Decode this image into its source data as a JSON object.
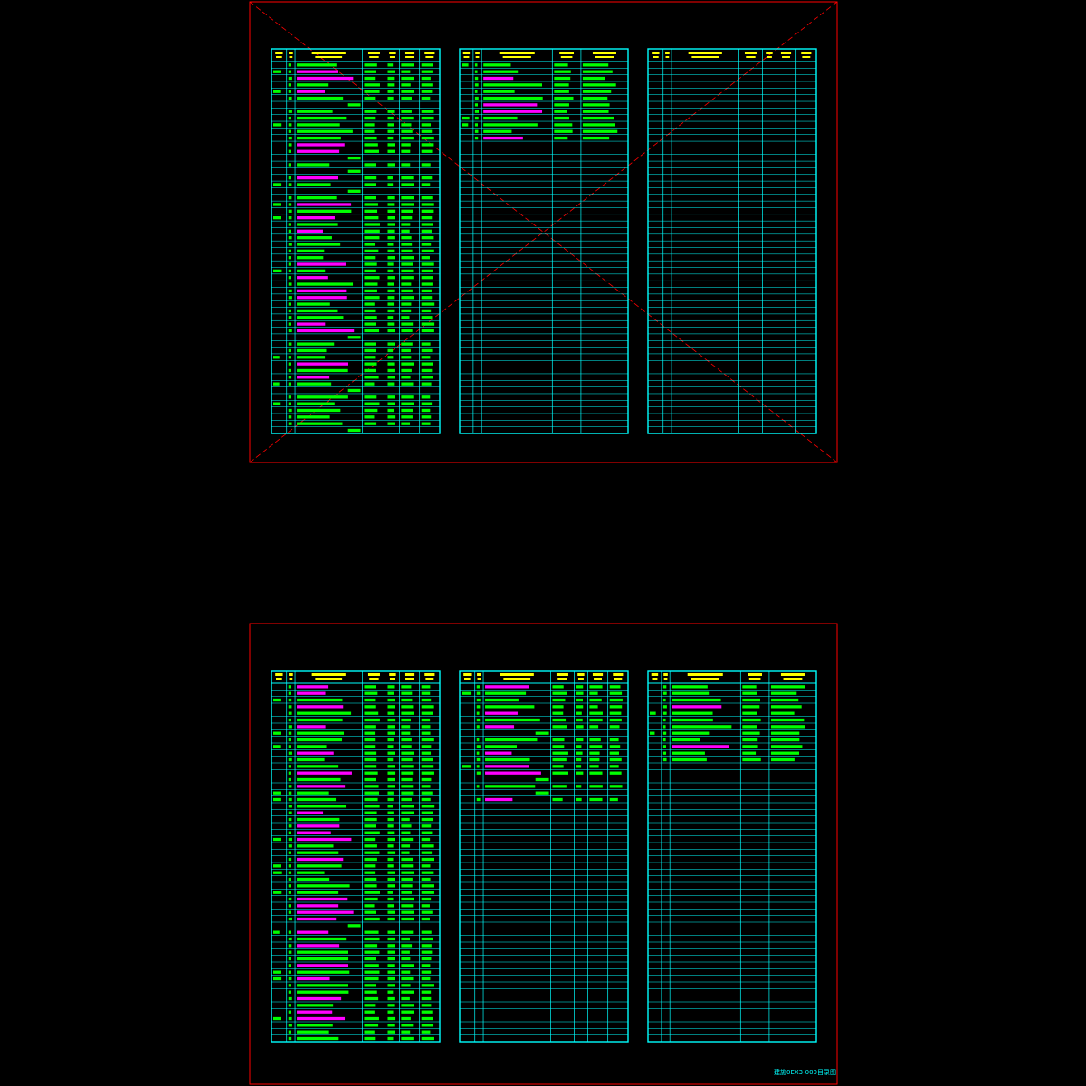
{
  "drawing": {
    "footer_label": "建施0EX3-000目录图",
    "colors": {
      "background": "#000000",
      "frame": "#ff0000",
      "grid": "#00ffff",
      "text_green": "#00ff00",
      "text_magenta": "#ff00ff",
      "text_yellow": "#ffff00"
    }
  },
  "sheets": [
    {
      "name": "sheet-top",
      "crossed_out": true,
      "panels": [
        {
          "name": "drawing-index-table-a",
          "kind": "index",
          "rows": 56
        },
        {
          "name": "standard-atlas-table",
          "kind": "atlas",
          "rows": 56,
          "filled_rows": 12
        },
        {
          "name": "blank-index-table",
          "kind": "blank",
          "rows": 56
        }
      ]
    },
    {
      "name": "sheet-bottom",
      "crossed_out": false,
      "panels": [
        {
          "name": "drawing-index-table-b",
          "kind": "index",
          "rows": 54
        },
        {
          "name": "drawing-index-table-c",
          "kind": "index-cont",
          "rows": 54,
          "filled_rows": 18
        },
        {
          "name": "standard-atlas-table-b",
          "kind": "atlas",
          "rows": 54,
          "filled_rows": 12
        }
      ]
    }
  ]
}
